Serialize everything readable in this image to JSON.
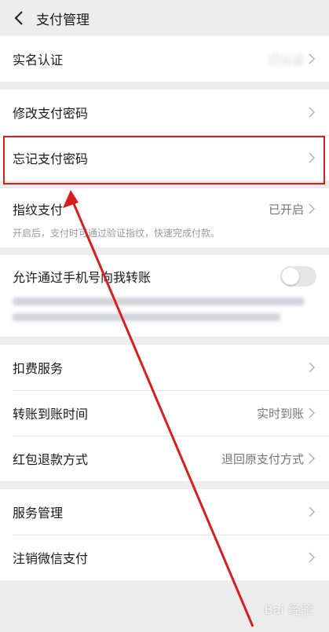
{
  "header": {
    "title": "支付管理"
  },
  "sections": [
    {
      "rows": [
        {
          "label": "实名认证",
          "value": "已认证"
        }
      ]
    },
    {
      "rows": [
        {
          "label": "修改支付密码",
          "value": ""
        },
        {
          "label": "忘记支付密码",
          "value": ""
        }
      ]
    },
    {
      "rows": [
        {
          "label": "指纹支付",
          "value": "已开启",
          "hint": "开启后，支付时可通过验证指纹，快速完成付款。"
        }
      ]
    },
    {
      "rows": [
        {
          "label": "允许通过手机号向我转账",
          "toggle": false
        }
      ]
    },
    {
      "rows": [
        {
          "label": "扣费服务",
          "value": ""
        },
        {
          "label": "转账到账时间",
          "value": "实时到账"
        },
        {
          "label": "红包退款方式",
          "value": "退回原支付方式"
        }
      ]
    },
    {
      "rows": [
        {
          "label": "服务管理",
          "value": ""
        },
        {
          "label": "注销微信支付",
          "value": ""
        }
      ]
    }
  ],
  "watermark": {
    "text": "Bai 经验"
  },
  "colors": {
    "highlight": "#d81e1e",
    "background": "#ededed",
    "card": "#ffffff"
  }
}
